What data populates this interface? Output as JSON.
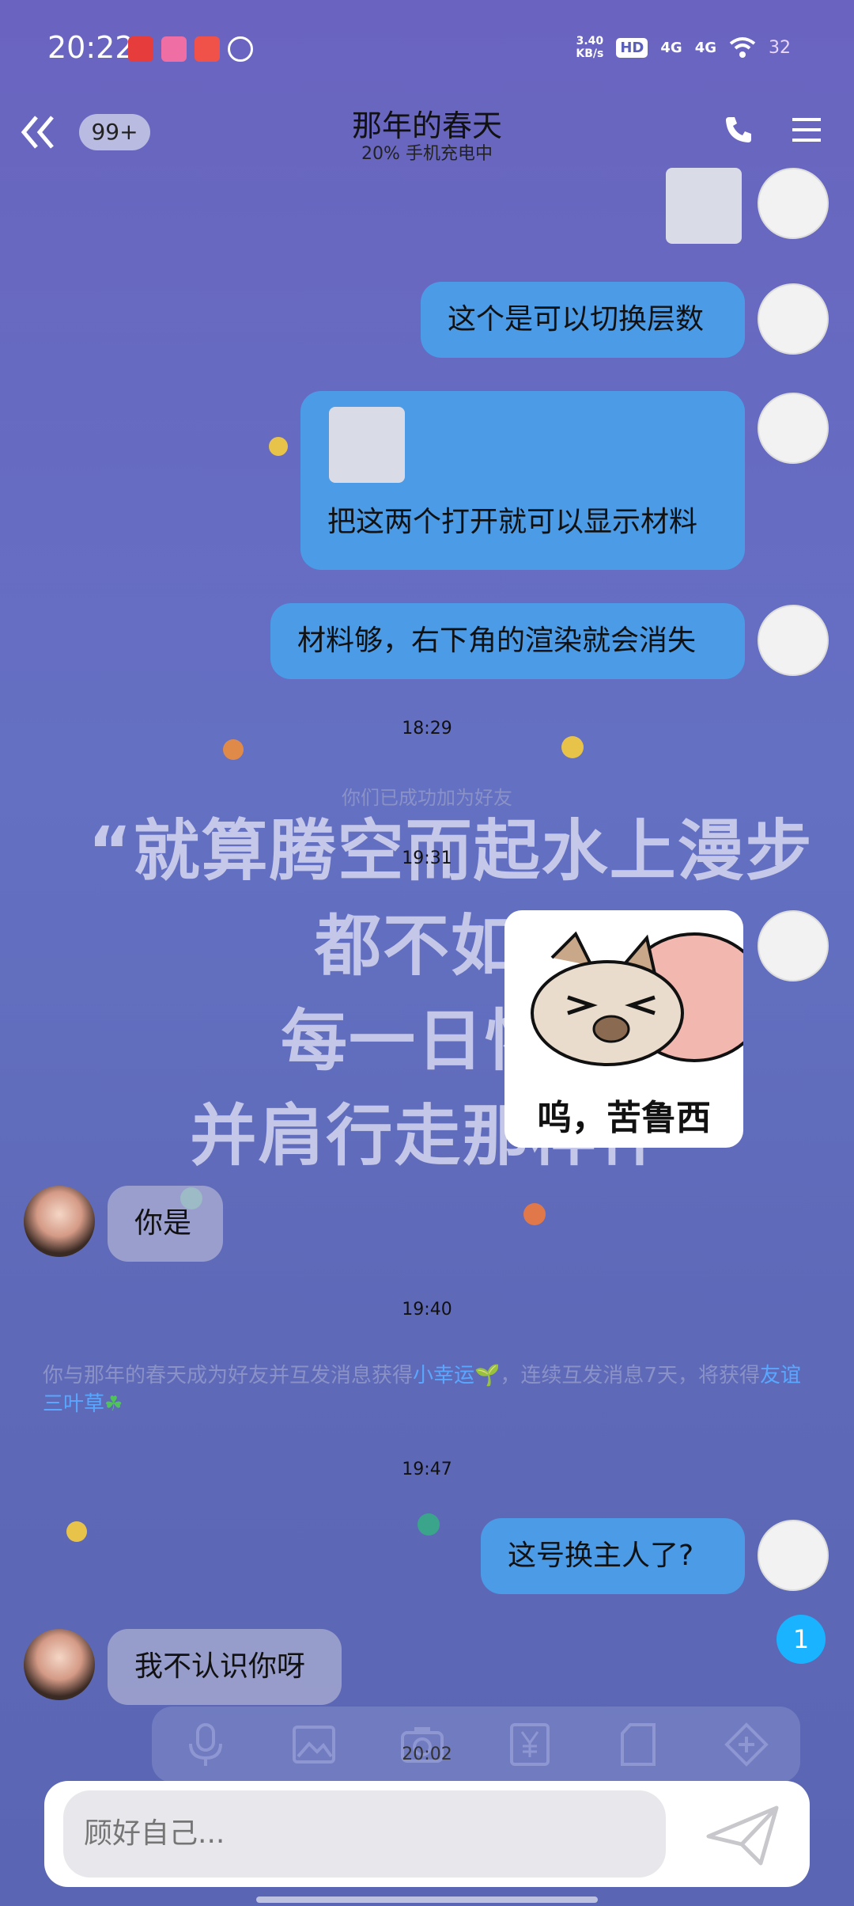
{
  "status_bar": {
    "time": "20:22",
    "net_speed_value": "3.40",
    "net_speed_unit": "KB/s",
    "hd_label": "HD",
    "network_1": "4G",
    "network_2": "4G",
    "battery": "32"
  },
  "header": {
    "back_icon": "chevron-left-icon",
    "unread_count": "99+",
    "contact_name": "那年的春天",
    "contact_status": "20% 手机充电中"
  },
  "messages": {
    "m1_text": "这个是可以切换层数",
    "m2_text": "把这两个打开就可以显示材料",
    "m3_text": "材料够，右下角的渲染就会消失",
    "time_1829": "18:29",
    "friend_added": "你们已成功加为好友",
    "time_1931": "19:31",
    "poster_line1": "“就算腾空而起水上漫步",
    "poster_line2": "都不如你",
    "poster_line3": "每一日怀揣",
    "poster_line4": "并肩行走那样伴”",
    "sticker_caption": "呜，苦鲁西",
    "her_1": "你是",
    "time_1940": "19:40",
    "sys_part1": "你与那年的春天成为好友并互发消息获得",
    "sys_link1": "小幸运",
    "sys_part2": "，连续互发消息7天，将获得",
    "sys_link2": "友谊三叶草",
    "time_1947": "19:47",
    "me_4": "这号换主人了?",
    "her_2": "我不认识你呀",
    "unread_badge": "1",
    "time_2002": "20:02"
  },
  "input": {
    "placeholder": "顾好自己..."
  },
  "colors": {
    "bubble_me": "#4b9be6",
    "badge": "#1ab3ff",
    "link": "#5aa7ff"
  }
}
